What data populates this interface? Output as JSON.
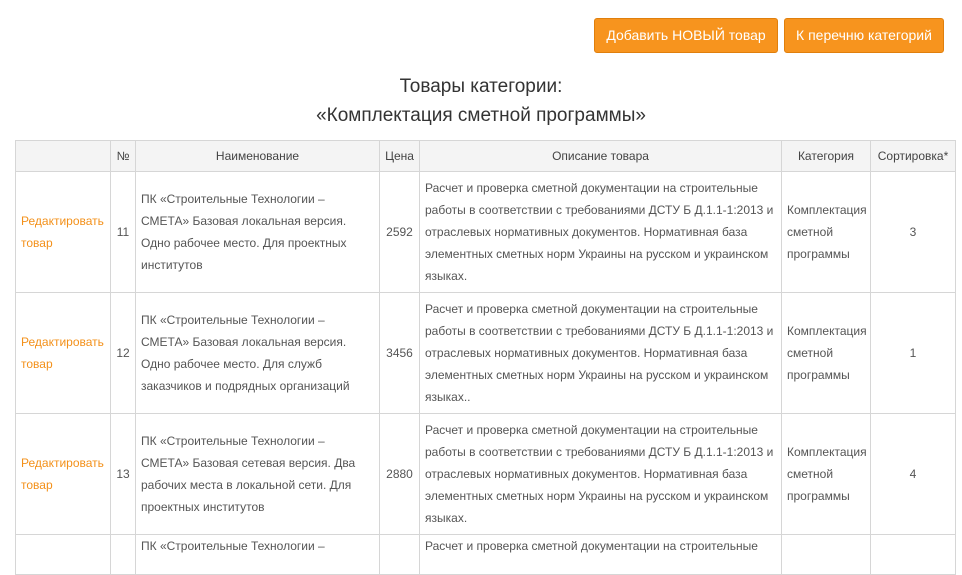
{
  "toolbar": {
    "add_label": "Добавить НОВЫЙ  товар",
    "categories_label": "К перечню категорий",
    "accent_color": "#f7941e"
  },
  "heading": {
    "line1": "Товары категории:",
    "line2": "«Комплектация сметной программы»"
  },
  "table": {
    "columns": [
      "",
      "№",
      "Наименование",
      "Цена",
      "Описание товара",
      "Категория",
      "Сортировка*"
    ],
    "rows": [
      {
        "edit": "Редактировать товар",
        "num": "11",
        "name": "ПК «Строительные Технологии – СМЕТА» Базовая локальная версия. Одно рабочее место. Для проектных институтов",
        "price": "2592",
        "description": "Расчет и проверка сметной документации на строительные работы в соответствии с требованиями ДСТУ Б Д.1.1-1:2013 и отраслевых нормативных документов. Нормативная база элементных сметных норм Украины на русском и украинском языках.",
        "category": "Комплектация сметной программы",
        "sort": "3"
      },
      {
        "edit": "Редактировать товар",
        "num": "12",
        "name": "ПК «Строительные Технологии – СМЕТА» Базовая локальная версия. Одно рабочее место. Для служб заказчиков и подрядных организаций",
        "price": "3456",
        "description": "Расчет и проверка сметной документации на строительные работы в соответствии с требованиями ДСТУ Б Д.1.1-1:2013 и отраслевых нормативных документов. Нормативная база элементных сметных норм Украины на русском и украинском языках..",
        "category": "Комплектация сметной программы",
        "sort": "1"
      },
      {
        "edit": "Редактировать товар",
        "num": "13",
        "name": "ПК «Строительные Технологии – СМЕТА» Базовая сетевая версия. Два рабочих места в локальной сети. Для проектных институтов",
        "price": "2880",
        "description": "Расчет и проверка сметной документации на строительные работы в соответствии с требованиями ДСТУ Б Д.1.1-1:2013 и отраслевых нормативных документов. Нормативная база элементных сметных норм Украины на русском и украинском языках.",
        "category": "Комплектация сметной программы",
        "sort": "4"
      },
      {
        "edit": "",
        "num": "",
        "name": "ПК «Строительные Технологии –",
        "price": "",
        "description": "Расчет и проверка сметной документации на строительные",
        "category": "",
        "sort": ""
      }
    ]
  }
}
